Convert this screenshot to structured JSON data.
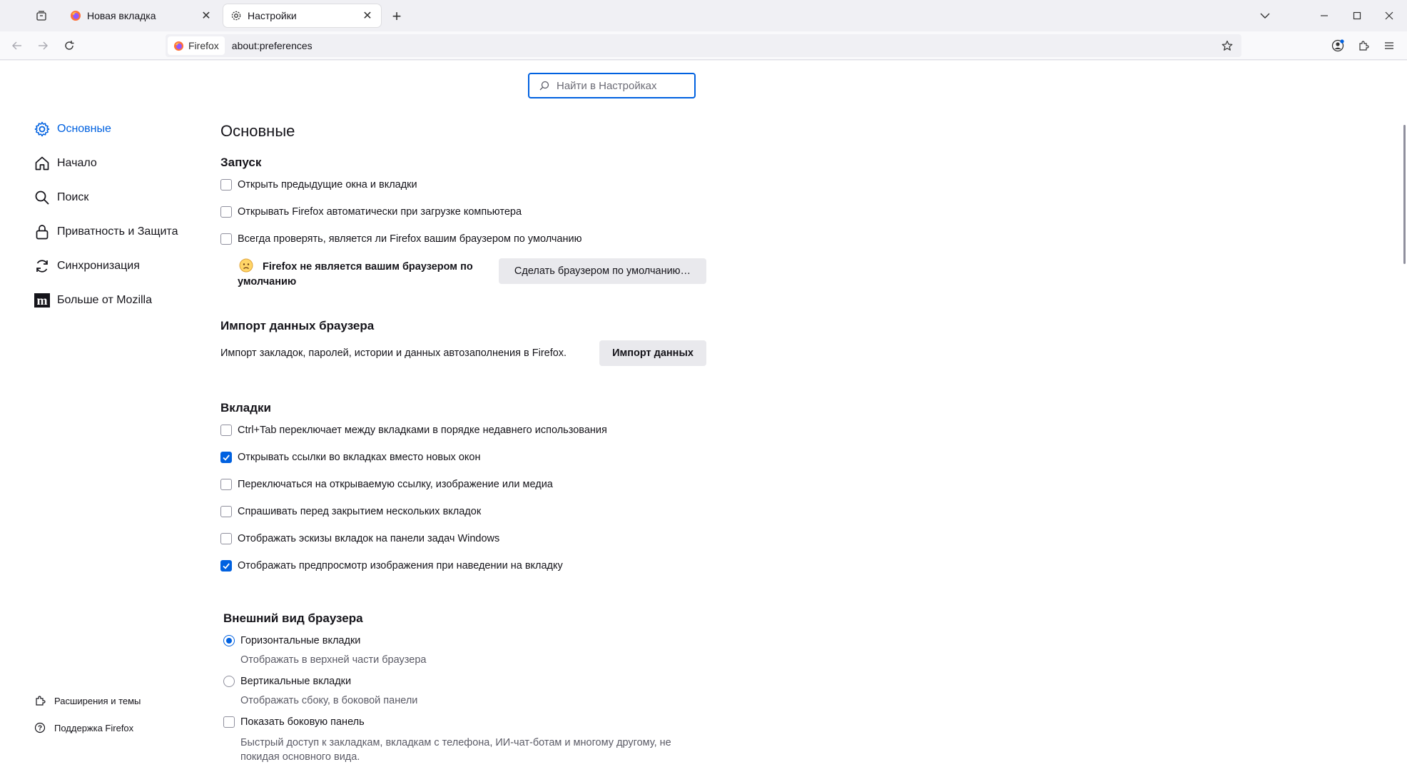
{
  "tabs": [
    {
      "label": "Новая вкладка",
      "favicon": "firefox-icon"
    },
    {
      "label": "Настройки",
      "favicon": "gear-icon"
    }
  ],
  "urlbar": {
    "identity_label": "Firefox",
    "url": "about:preferences"
  },
  "search": {
    "placeholder": "Найти в Настройках"
  },
  "sidebar": {
    "items": [
      {
        "label": "Основные",
        "icon": "gear-icon",
        "selected": true
      },
      {
        "label": "Начало",
        "icon": "home-icon"
      },
      {
        "label": "Поиск",
        "icon": "search-icon"
      },
      {
        "label": "Приватность и Защита",
        "icon": "lock-icon"
      },
      {
        "label": "Синхронизация",
        "icon": "sync-icon"
      },
      {
        "label": "Больше от Mozilla",
        "icon": "mozilla-icon"
      }
    ],
    "footer": [
      {
        "label": "Расширения и темы",
        "icon": "puzzle-icon"
      },
      {
        "label": "Поддержка Firefox",
        "icon": "help-icon"
      }
    ]
  },
  "main": {
    "title": "Основные",
    "startup": {
      "heading": "Запуск",
      "options": [
        {
          "label": "Открыть предыдущие окна и вкладки",
          "checked": false
        },
        {
          "label": "Открывать Firefox автоматически при загрузке компьютера",
          "checked": false
        },
        {
          "label": "Всегда проверять, является ли Firefox вашим браузером по умолчанию",
          "checked": false
        }
      ],
      "default_status_line1": "Firefox не является вашим браузером по",
      "default_status_line2": "умолчанию",
      "make_default_button": "Сделать браузером по умолчанию…"
    },
    "import": {
      "heading": "Импорт данных браузера",
      "description": "Импорт закладок, паролей, истории и данных автозаполнения в Firefox.",
      "button": "Импорт данных"
    },
    "tabs": {
      "heading": "Вкладки",
      "options": [
        {
          "label": "Ctrl+Tab переключает между вкладками в порядке недавнего использования",
          "checked": false
        },
        {
          "label": "Открывать ссылки во вкладках вместо новых окон",
          "checked": true
        },
        {
          "label": "Переключаться на открываемую ссылку, изображение или медиа",
          "checked": false
        },
        {
          "label": "Спрашивать перед закрытием нескольких вкладок",
          "checked": false
        },
        {
          "label": "Отображать эскизы вкладок на панели задач Windows",
          "checked": false
        },
        {
          "label": "Отображать предпросмотр изображения при наведении на вкладку",
          "checked": true
        }
      ]
    },
    "appearance": {
      "heading": "Внешний вид браузера",
      "horizontal_label": "Горизонтальные вкладки",
      "horizontal_desc": "Отображать в верхней части браузера",
      "vertical_label": "Вертикальные вкладки",
      "vertical_desc": "Отображать сбоку, в боковой панели",
      "sidebar_label": "Показать боковую панель",
      "sidebar_desc_line1": "Быстрый доступ к закладкам, вкладкам с телефона, ИИ-чат-ботам и многому другому, не",
      "sidebar_desc_line2": "покидая основного вида.",
      "selected": "horizontal"
    }
  },
  "colors": {
    "accent": "#0061e0",
    "chrome_bg": "#f0f0f4"
  }
}
